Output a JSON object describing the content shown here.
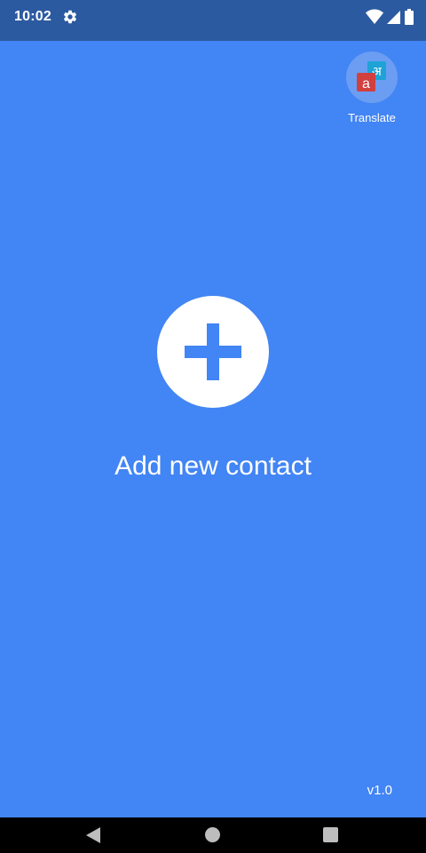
{
  "status_bar": {
    "time": "10:02",
    "icons": [
      "settings-gear-icon",
      "wifi-icon",
      "cellular-signal-icon",
      "battery-icon"
    ]
  },
  "main": {
    "background_color": "#4285F4",
    "translate_bubble": {
      "label": "Translate",
      "icon": "translate-app-icon",
      "glyph_latin": "a",
      "glyph_devanagari": "अ"
    },
    "add_contact": {
      "icon": "plus-icon",
      "label": "Add new contact"
    },
    "version": "v1.0"
  },
  "nav_bar": {
    "buttons": [
      "back-icon",
      "home-icon",
      "recent-apps-icon"
    ]
  }
}
